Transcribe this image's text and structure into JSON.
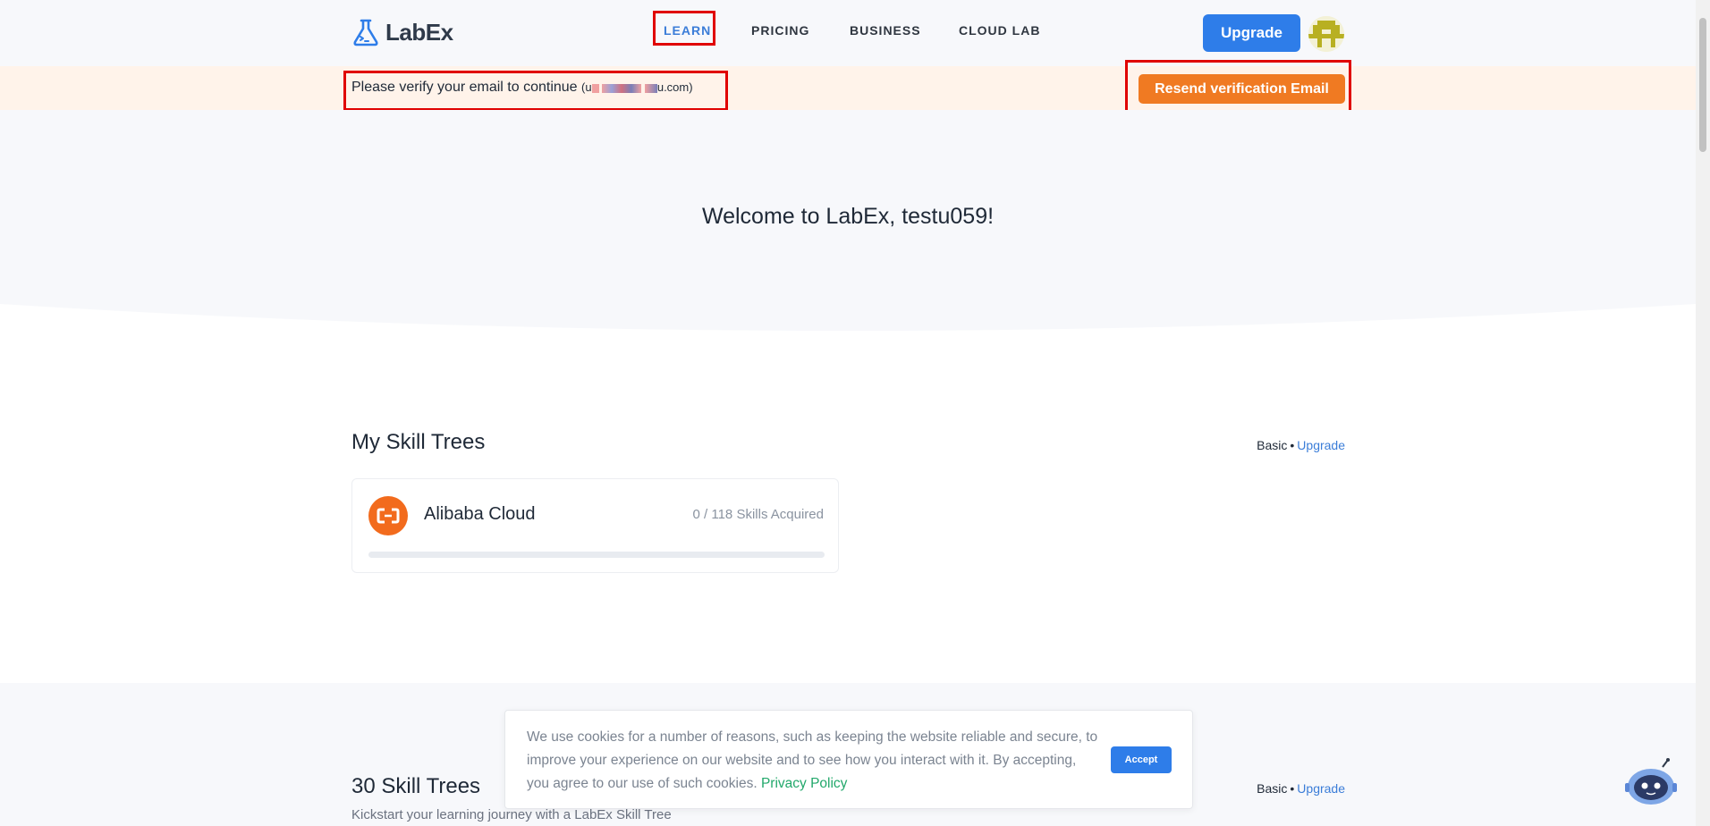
{
  "header": {
    "logo_text": "LabEx",
    "nav": [
      {
        "label": "LEARN",
        "active": true
      },
      {
        "label": "PRICING",
        "active": false
      },
      {
        "label": "BUSINESS",
        "active": false
      },
      {
        "label": "CLOUD LAB",
        "active": false
      }
    ],
    "upgrade_label": "Upgrade",
    "avatar_icon": "user-avatar-icon"
  },
  "banner": {
    "message": "Please verify your email to continue",
    "email_open": "(u",
    "email_close": "u.com)",
    "resend_label": "Resend verification Email"
  },
  "hero": {
    "welcome": "Welcome to LabEx, testu059!"
  },
  "my_skill_trees": {
    "title": "My Skill Trees",
    "plan": "Basic",
    "plan_sep": "•",
    "upgrade_link": "Upgrade",
    "cards": [
      {
        "name": "Alibaba Cloud",
        "acquired_text": "0 / 118 Skills Acquired",
        "acquired": 0,
        "total": 118,
        "icon": "alibaba-cloud-icon"
      }
    ]
  },
  "all_skill_trees": {
    "title": "30 Skill Trees",
    "subtitle": "Kickstart your learning journey with a LabEx Skill Tree",
    "plan": "Basic",
    "plan_sep": "•",
    "upgrade_link": "Upgrade"
  },
  "cookie": {
    "text": "We use cookies for a number of reasons, such as keeping the website reliable and secure, to improve your experience on our website and to see how you interact with it. By accepting, you agree to our use of such cookies.",
    "link": "Privacy Policy",
    "accept_label": "Accept"
  },
  "assistant": {
    "icon": "robot-assistant-icon"
  },
  "colors": {
    "accent": "#2e7de9",
    "banner_bg": "#fff3ea",
    "resend": "#f07a22",
    "highlight_box": "#e00000",
    "link_green": "#22a86b"
  }
}
